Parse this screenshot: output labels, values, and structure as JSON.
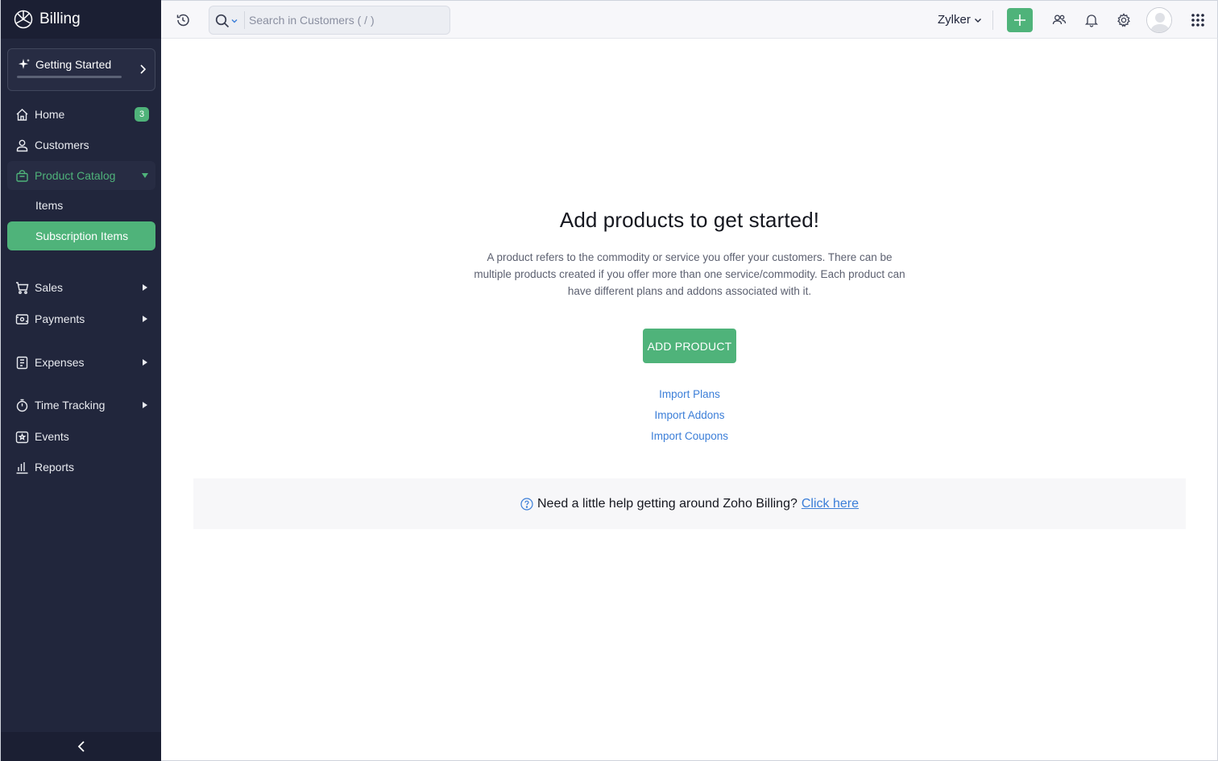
{
  "app": {
    "name": "Billing"
  },
  "getting_started": {
    "label": "Getting Started"
  },
  "sidebar": {
    "home": {
      "label": "Home",
      "badge": "3"
    },
    "customers": {
      "label": "Customers"
    },
    "product_catalog": {
      "label": "Product Catalog",
      "items": [
        {
          "label": "Items"
        },
        {
          "label": "Subscription Items"
        }
      ]
    },
    "sales": {
      "label": "Sales"
    },
    "payments": {
      "label": "Payments"
    },
    "expenses": {
      "label": "Expenses"
    },
    "time_tracking": {
      "label": "Time Tracking"
    },
    "events": {
      "label": "Events"
    },
    "reports": {
      "label": "Reports"
    }
  },
  "topbar": {
    "search_placeholder": "Search in Customers ( / )",
    "org_name": "Zylker"
  },
  "empty_state": {
    "title": "Add products to get started!",
    "description": "A product refers to the commodity or service you offer your customers. There can be multiple products created if you offer more than one service/commodity. Each product can have different plans and addons associated with it.",
    "primary_button": "ADD PRODUCT",
    "links": [
      "Import Plans",
      "Import Addons",
      "Import Coupons"
    ]
  },
  "help": {
    "text": "Need a little help getting around Zoho Billing?",
    "link": "Click here"
  },
  "colors": {
    "sidebar_bg": "#21263c",
    "accent_green": "#4fb37a",
    "link_blue": "#3b7ed8"
  }
}
